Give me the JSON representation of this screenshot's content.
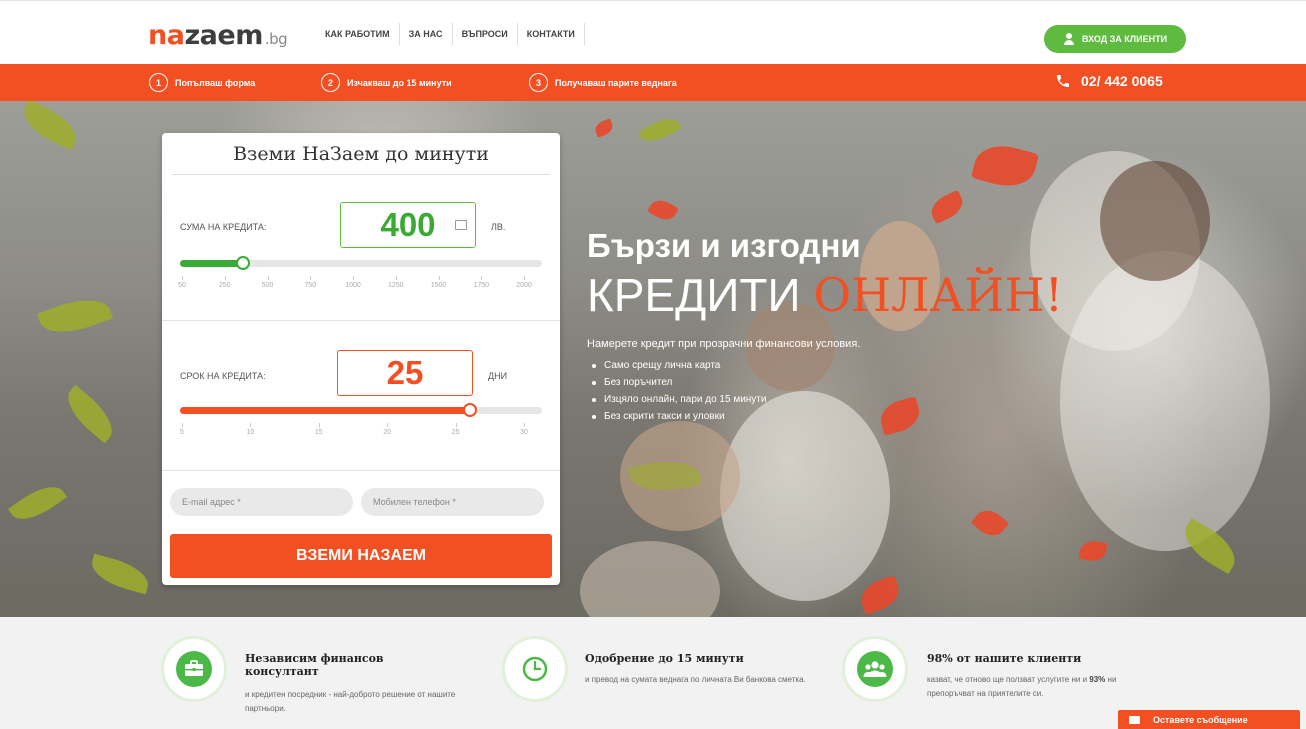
{
  "brand": {
    "name_part1": "na",
    "name_part2": "zaem",
    "tld": ".bg",
    "accent": "#f25022",
    "green": "#4cb848"
  },
  "nav": {
    "items": [
      "КАК РАБОТИМ",
      "ЗА НАС",
      "ВЪПРОСИ",
      "КОНТАКТИ"
    ]
  },
  "login": {
    "label": "ВХОД ЗА КЛИЕНТИ",
    "icon": "user-icon"
  },
  "steps": [
    {
      "num": "1",
      "label": "Попълваш форма"
    },
    {
      "num": "2",
      "label": "Изчакваш до 15 минути"
    },
    {
      "num": "3",
      "label": "Получаваш парите веднага"
    }
  ],
  "phone": {
    "number": "02/ 442 0065",
    "icon": "phone-icon"
  },
  "form": {
    "title": "Вземи НаЗаем до минути",
    "amount": {
      "label": "СУМА НА КРЕДИТА:",
      "value": "400",
      "unit": "ЛВ.",
      "fraction": 0.175,
      "ticks": [
        "50",
        "250",
        "500",
        "750",
        "1000",
        "1250",
        "1500",
        "1750",
        "2000"
      ]
    },
    "term": {
      "label": "СРОК НА КРЕДИТА:",
      "value": "25",
      "unit": "ДНИ",
      "fraction": 0.8,
      "ticks": [
        "5",
        "10",
        "15",
        "20",
        "25",
        "30"
      ]
    },
    "email_placeholder": "E-mail адрес *",
    "phone_placeholder": "Мобилен телефон *",
    "submit": "ВЗЕМИ НАЗАЕМ"
  },
  "hero": {
    "headline1": "Бързи и изгодни",
    "headline2_white": "КРЕДИТИ ",
    "headline2_orange": "ОНЛАЙН!",
    "lead": "Намерете кредит при прозрачни финансови условия.",
    "bullets": [
      "Само срещу лична карта",
      "Без поръчител",
      "Изцяло онлайн, пари до 15 минути",
      "Без скрити такси и уловки"
    ]
  },
  "features": [
    {
      "icon": "briefcase-icon",
      "title": "Независим финансов консултант",
      "desc": "и кредитен посредник - най-доброто решение от нашите партньори."
    },
    {
      "icon": "clock-icon",
      "title": "Одобрение до 15 минути",
      "desc": "и превод на сумата веднага по личната Ви банкова сметка."
    },
    {
      "icon": "users-icon",
      "title": "98% от нашите клиенти",
      "desc_pre": "казват, че отново ще ползват услугите ни и ",
      "desc_bold": "93%",
      "desc_post": " ни препоръчват на приятелите си."
    }
  ],
  "message_button": {
    "label": "Оставете съобщение",
    "icon": "envelope-icon"
  }
}
